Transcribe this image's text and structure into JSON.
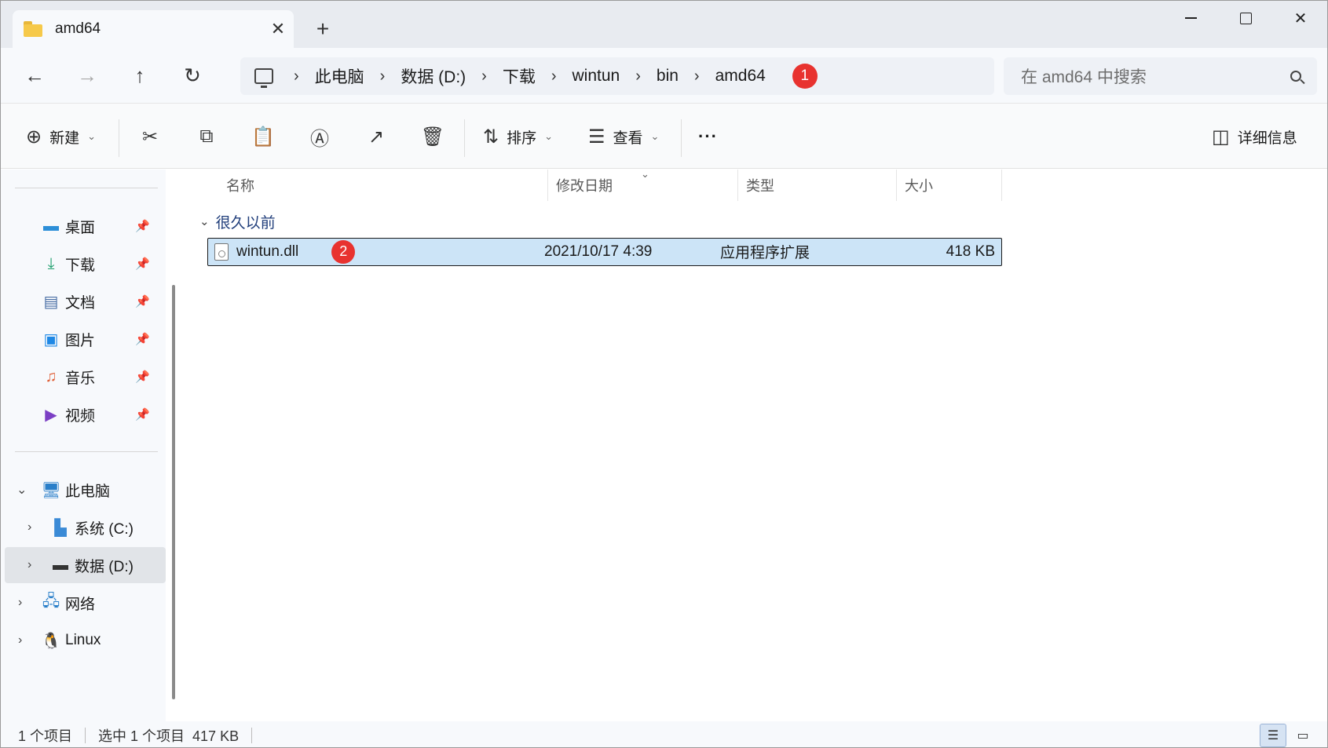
{
  "window": {
    "tab_title": "amd64",
    "tab_close": "✕",
    "new_tab": "+",
    "controls": {
      "minimize": "",
      "maximize": "",
      "close": "✕"
    }
  },
  "nav": {
    "back": "←",
    "forward": "→",
    "up": "↑",
    "refresh": "↻",
    "breadcrumbs": [
      "此电脑",
      "数据 (D:)",
      "下载",
      "wintun",
      "bin",
      "amd64"
    ],
    "breadcrumb_separator": "›",
    "address_badge": "1",
    "search_placeholder": "在 amd64 中搜索"
  },
  "commands": {
    "new_label": "新建",
    "sort_label": "排序",
    "view_label": "查看",
    "more_label": "···",
    "details_label": "详细信息",
    "icons": [
      "plus-circle-icon",
      "cut-icon",
      "copy-icon",
      "paste-icon",
      "rename-icon",
      "share-icon",
      "delete-icon",
      "sort-icon",
      "view-icon",
      "details-pane-icon"
    ]
  },
  "sidebar": {
    "quick_access": [
      {
        "label": "桌面",
        "icon": "desktop-icon",
        "pinned": true
      },
      {
        "label": "下载",
        "icon": "download-icon",
        "pinned": true
      },
      {
        "label": "文档",
        "icon": "documents-icon",
        "pinned": true
      },
      {
        "label": "图片",
        "icon": "pictures-icon",
        "pinned": true
      },
      {
        "label": "音乐",
        "icon": "music-icon",
        "pinned": true
      },
      {
        "label": "视频",
        "icon": "videos-icon",
        "pinned": true
      }
    ],
    "this_pc": "此电脑",
    "drives": [
      {
        "label": "系统 (C:)",
        "icon": "system-drive-icon"
      },
      {
        "label": "数据 (D:)",
        "icon": "data-drive-icon",
        "selected": true
      }
    ],
    "network": "网络",
    "linux": "Linux"
  },
  "columns": {
    "name": "名称",
    "modified": "修改日期",
    "type": "类型",
    "size": "大小"
  },
  "group_label": "很久以前",
  "files": [
    {
      "name": "wintun.dll",
      "modified": "2021/10/17 4:39",
      "type": "应用程序扩展",
      "size": "418 KB",
      "badge": "2",
      "selected": true
    }
  ],
  "status": {
    "item_count": "1 个项目",
    "selection": "选中 1 个项目  417 KB"
  },
  "colors": {
    "selection_bg": "#cce4f7",
    "badge_red": "#e8322f",
    "tab_bar": "#e8ebf0"
  }
}
